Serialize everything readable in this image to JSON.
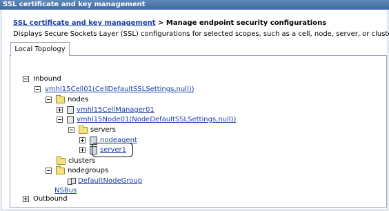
{
  "window": {
    "title": "SSL certificate and key management"
  },
  "breadcrumb": {
    "link": "SSL certificate and key management",
    "separator": ">",
    "current": "Manage endpoint security configurations"
  },
  "description": "Displays Secure Sockets Layer (SSL) configurations for selected scopes, such as a cell, node, server, or cluster.",
  "tabs": [
    {
      "label": "Local Topology",
      "selected": true
    }
  ],
  "tree": {
    "inbound": "Inbound",
    "cell": "vmhl15Cell01(CellDefaultSSLSettings,null))",
    "nodes": "nodes",
    "cell_manager": "vmhl15CellManager01",
    "node": "vmhl15Node01(NodeDefaultSSLSettings,null))",
    "servers": "servers",
    "nodeagent": "nodeagent",
    "server1": "server1",
    "clusters": "clusters",
    "nodegroups": "nodegroups",
    "default_node_group": "DefaultNodeGroup",
    "nsbus": "NSBus",
    "outbound": "Outbound"
  },
  "colors": {
    "titlebar": "#3d6aa1",
    "link": "#1a3fa6",
    "folder": "#f6e27a"
  }
}
